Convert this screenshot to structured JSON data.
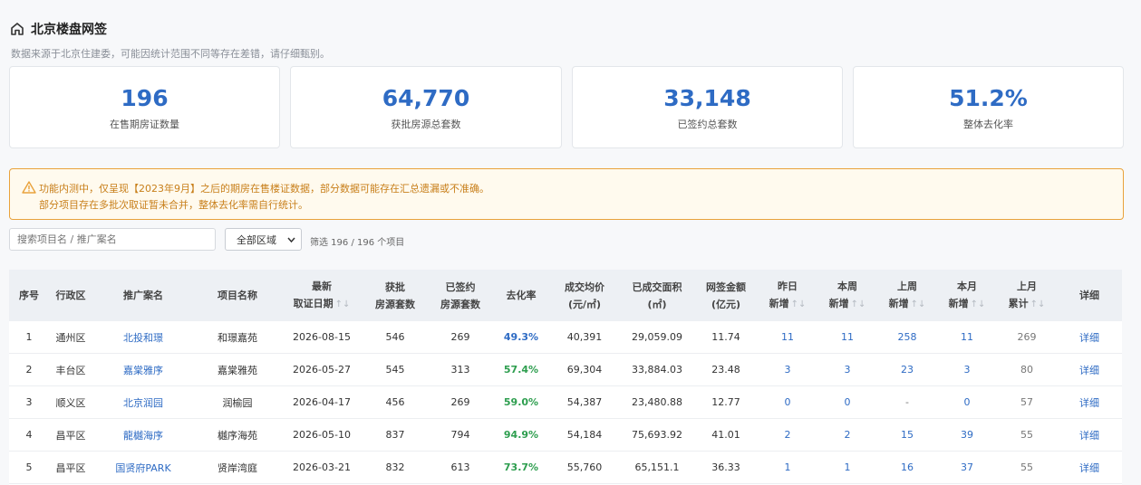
{
  "header": {
    "title": "北京楼盘网签",
    "subtitle": "数据来源于北京住建委，可能因统计范围不同等存在差错，请仔细甄别。"
  },
  "stats": [
    {
      "value": "196",
      "label": "在售期房证数量"
    },
    {
      "value": "64,770",
      "label": "获批房源总套数"
    },
    {
      "value": "33,148",
      "label": "已签约总套数"
    },
    {
      "value": "51.2%",
      "label": "整体去化率"
    }
  ],
  "alert": {
    "line1": "功能内测中，仅呈现【2023年9月】之后的期房在售楼证数据，部分数据可能存在汇总遗漏或不准确。",
    "line2": "部分项目存在多批次取证暂未合并，整体去化率需自行统计。",
    "accent": "#e9a23b"
  },
  "filters": {
    "search_placeholder": "搜索项目名 / 推广案名",
    "region_selected": "全部区域",
    "count_text": "筛选 196 / 196 个项目"
  },
  "table": {
    "headers": [
      {
        "line1": "序号",
        "line2": "",
        "sortable": false
      },
      {
        "line1": "行政区",
        "line2": "",
        "sortable": false
      },
      {
        "line1": "推广案名",
        "line2": "",
        "sortable": false
      },
      {
        "line1": "项目名称",
        "line2": "",
        "sortable": false
      },
      {
        "line1": "最新",
        "line2": "取证日期",
        "sortable": true
      },
      {
        "line1": "获批",
        "line2": "房源套数",
        "sortable": false
      },
      {
        "line1": "已签约",
        "line2": "房源套数",
        "sortable": false
      },
      {
        "line1": "去化率",
        "line2": "",
        "sortable": false
      },
      {
        "line1": "成交均价",
        "line2": "(元/㎡)",
        "sortable": false
      },
      {
        "line1": "已成交面积",
        "line2": "(㎡)",
        "sortable": false
      },
      {
        "line1": "网签金额",
        "line2": "(亿元)",
        "sortable": false
      },
      {
        "line1": "昨日",
        "line2": "新增",
        "sortable": true
      },
      {
        "line1": "本周",
        "line2": "新增",
        "sortable": true
      },
      {
        "line1": "上周",
        "line2": "新增",
        "sortable": true
      },
      {
        "line1": "本月",
        "line2": "新增",
        "sortable": true
      },
      {
        "line1": "上月",
        "line2": "累计",
        "sortable": true
      },
      {
        "line1": "详细",
        "line2": "",
        "sortable": false
      }
    ],
    "rows": [
      {
        "no": "1",
        "district": "通州区",
        "promo": "北投和璟",
        "project": "和璟嘉苑",
        "date": "2026-08-15",
        "approved": "546",
        "signed": "269",
        "rate": "49.3%",
        "rate_color": "blue",
        "price": "40,391",
        "area": "29,059.09",
        "amount": "11.74",
        "yesterday": "11",
        "this_week": "11",
        "last_week": "258",
        "this_month": "11",
        "last_month": "269",
        "detail": "详细"
      },
      {
        "no": "2",
        "district": "丰台区",
        "promo": "嘉棠雅序",
        "project": "嘉棠雅苑",
        "date": "2026-05-27",
        "approved": "545",
        "signed": "313",
        "rate": "57.4%",
        "rate_color": "green",
        "price": "69,304",
        "area": "33,884.03",
        "amount": "23.48",
        "yesterday": "3",
        "this_week": "3",
        "last_week": "23",
        "this_month": "3",
        "last_month": "80",
        "detail": "详细"
      },
      {
        "no": "3",
        "district": "顺义区",
        "promo": "北京润园",
        "project": "润榆园",
        "date": "2026-04-17",
        "approved": "456",
        "signed": "269",
        "rate": "59.0%",
        "rate_color": "green",
        "price": "54,387",
        "area": "23,480.88",
        "amount": "12.77",
        "yesterday": "0",
        "this_week": "0",
        "last_week": "-",
        "this_month": "0",
        "last_month": "57",
        "detail": "详细"
      },
      {
        "no": "4",
        "district": "昌平区",
        "promo": "龍樾海序",
        "project": "樾序海苑",
        "date": "2026-05-10",
        "approved": "837",
        "signed": "794",
        "rate": "94.9%",
        "rate_color": "green",
        "price": "54,184",
        "area": "75,693.92",
        "amount": "41.01",
        "yesterday": "2",
        "this_week": "2",
        "last_week": "15",
        "this_month": "39",
        "last_month": "55",
        "detail": "详细"
      },
      {
        "no": "5",
        "district": "昌平区",
        "promo": "国贤府PARK",
        "project": "贤岸湾庭",
        "date": "2026-03-21",
        "approved": "832",
        "signed": "613",
        "rate": "73.7%",
        "rate_color": "green",
        "price": "55,760",
        "area": "65,151.1",
        "amount": "36.33",
        "yesterday": "1",
        "this_week": "1",
        "last_week": "16",
        "this_month": "37",
        "last_month": "55",
        "detail": "详细"
      }
    ]
  },
  "colors": {
    "accent": "#2e6bc4",
    "green": "#2e9e4f",
    "warning": "#c87f1a"
  }
}
